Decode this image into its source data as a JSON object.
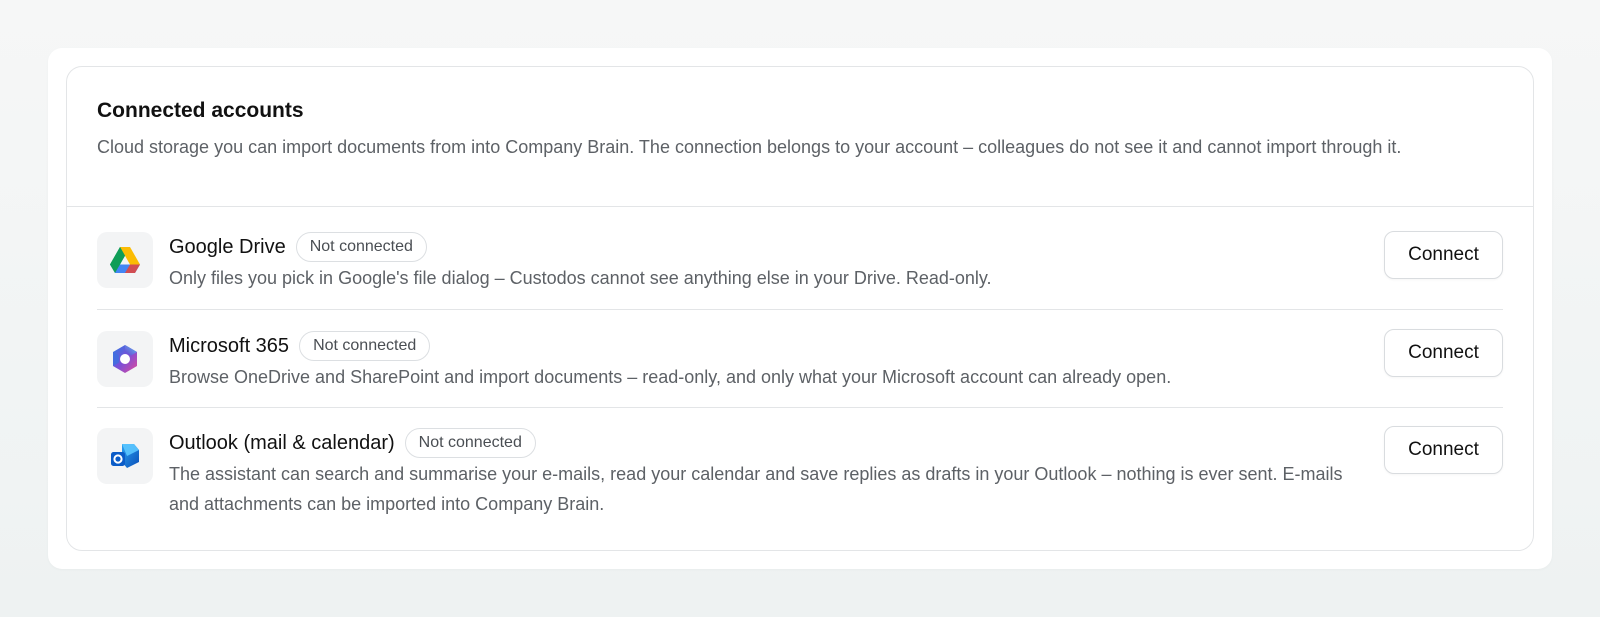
{
  "section": {
    "title": "Connected accounts",
    "description": "Cloud storage you can import documents from into Company Brain. The connection belongs to your account – colleagues do not see it and cannot import through it."
  },
  "accounts": [
    {
      "name": "Google Drive",
      "status": "Not connected",
      "description": "Only files you pick in Google's file dialog – Custodos cannot see anything else in your Drive. Read-only.",
      "action_label": "Connect",
      "icon": "google-drive-icon"
    },
    {
      "name": "Microsoft 365",
      "status": "Not connected",
      "description": "Browse OneDrive and SharePoint and import documents – read-only, and only what your Microsoft account can already open.",
      "action_label": "Connect",
      "icon": "microsoft-365-icon"
    },
    {
      "name": "Outlook (mail & calendar)",
      "status": "Not connected",
      "description": "The assistant can search and summarise your e-mails, read your calendar and save replies as drafts in your Outlook – nothing is ever sent. E-mails and attachments can be imported into Company Brain.",
      "action_label": "Connect",
      "icon": "outlook-icon"
    }
  ]
}
